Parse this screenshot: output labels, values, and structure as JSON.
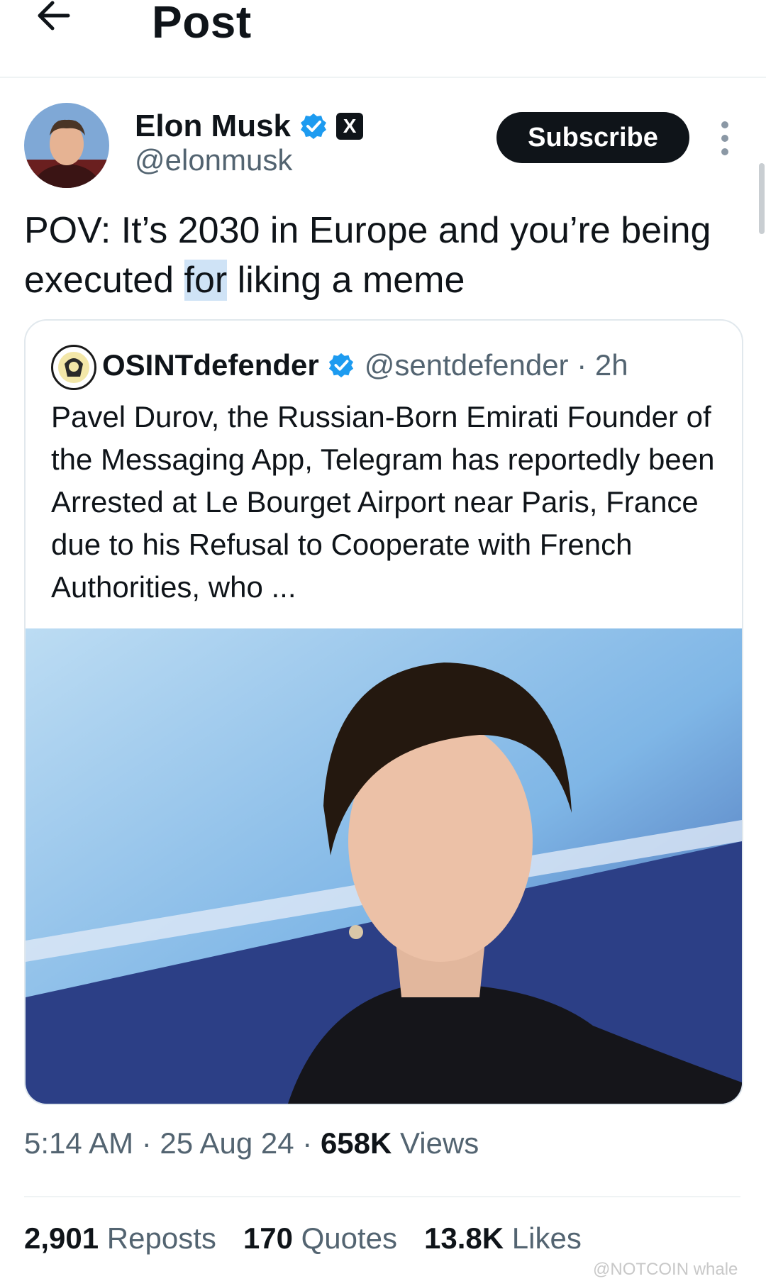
{
  "header": {
    "title": "Post",
    "back_icon": "arrow-left-icon"
  },
  "author": {
    "name": "Elon Musk",
    "handle": "@elonmusk",
    "verified_icon": "verified-badge-icon",
    "affiliate_badge": "X"
  },
  "subscribe_label": "Subscribe",
  "post": {
    "text_before": "POV: It’s 2030 in Europe and you’re being executed ",
    "text_highlight": "for",
    "text_after": " liking a meme"
  },
  "quote": {
    "name": "OSINTdefender",
    "handle_time": "@sentdefender · 2h",
    "text": "Pavel Durov, the Russian-Born Emirati Founder of the Messaging App, Telegram has reportedly been Arrested at Le Bourget Airport near Paris, France due to his Refusal to Cooperate with French Authorities, who ..."
  },
  "meta": {
    "time_date": "5:14 AM · 25 Aug 24 · ",
    "views_count": "658K",
    "views_label": " Views"
  },
  "stats": {
    "reposts_count": "2,901",
    "reposts_label": "Reposts",
    "quotes_count": "170",
    "quotes_label": "Quotes",
    "likes_count": "13.8K",
    "likes_label": "Likes"
  },
  "watermark": "@NOTCOIN whale",
  "colors": {
    "verified": "#1d9bf0",
    "text": "#0f1419",
    "secondary": "#536471",
    "highlight": "#cfe3f6"
  }
}
